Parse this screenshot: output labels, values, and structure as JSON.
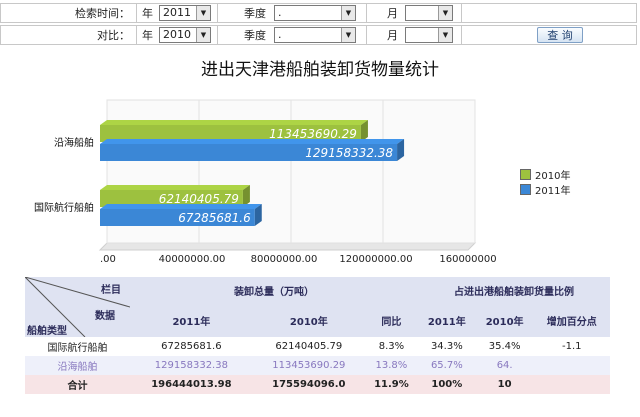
{
  "filter": {
    "row1": {
      "label": "检索时间：",
      "year_unit": "年",
      "year": "2011",
      "quarter_label": "季度",
      "quarter": ".",
      "month_label": "月",
      "month": ""
    },
    "row2": {
      "label": "对比：",
      "year_unit": "年",
      "year": "2010",
      "quarter_label": "季度",
      "quarter": ".",
      "month_label": "月",
      "month": ""
    },
    "query_button": "查 询"
  },
  "chart_title": "进出天津港船舶装卸货物量统计",
  "chart_data": {
    "type": "bar",
    "orientation": "horizontal",
    "categories": [
      "沿海船舶",
      "国际航行船舶"
    ],
    "series": [
      {
        "name": "2010年",
        "color": "#9dc13f",
        "values": [
          113453690.29,
          62140405.79
        ],
        "labels": [
          "113453690.29",
          "62140405.79"
        ]
      },
      {
        "name": "2011年",
        "color": "#3b87d6",
        "values": [
          129158332.38,
          67285681.6
        ],
        "labels": [
          "129158332.38",
          "67285681.6"
        ]
      }
    ],
    "xlim": [
      0,
      160000000
    ],
    "ticks": [
      ".00",
      "40000000.00",
      "80000000.00",
      "120000000.00",
      "160000000"
    ],
    "legend_position": "right"
  },
  "table": {
    "corner": {
      "top": "栏目",
      "middle": "数据",
      "bottom": "船舶类型"
    },
    "group1": "装卸总量（万吨）",
    "group2": "占进出港船舶装卸货量比例",
    "cols": [
      "2011年",
      "2010年",
      "同比",
      "2011年",
      "2010年",
      "增加百分点"
    ],
    "rows": [
      {
        "name": "国际航行船舶",
        "cells": [
          "67285681.6",
          "62140405.79",
          "8.3%",
          "34.3%",
          "35.4%",
          "-1.1"
        ]
      },
      {
        "name": "沿海船舶",
        "cells": [
          "129158332.38",
          "113453690.29",
          "13.8%",
          "65.7%",
          "64.",
          ""
        ]
      },
      {
        "name": "合计",
        "cells": [
          "196444013.98",
          "175594096.0",
          "11.9%",
          "100%",
          "10",
          ""
        ]
      }
    ]
  }
}
